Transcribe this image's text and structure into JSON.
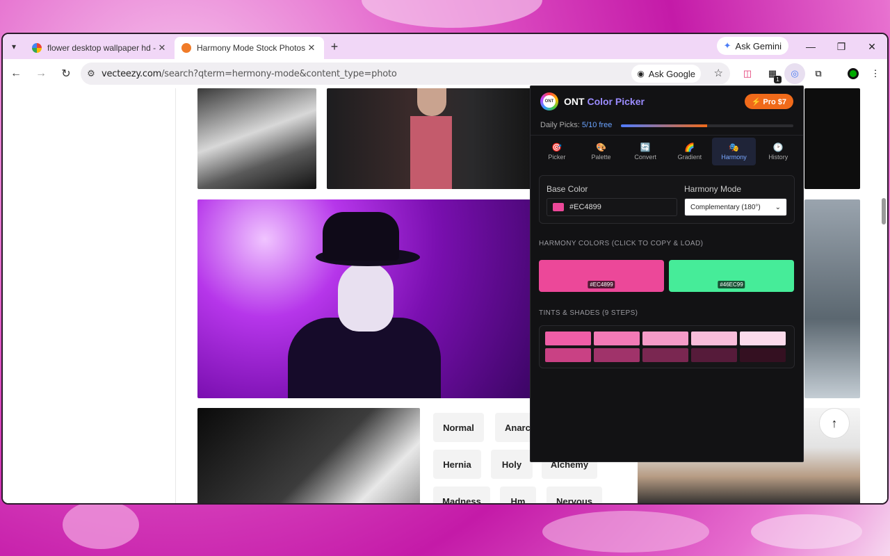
{
  "browser": {
    "tabs": [
      {
        "title": "flower desktop wallpaper hd - G",
        "favicon_color": "#4285f4"
      },
      {
        "title": "Harmony Mode Stock Photos, I",
        "favicon_color": "#f07b28"
      }
    ],
    "new_tab": "+",
    "gemini_label": "Ask Gemini",
    "url_host": "vecteezy.com",
    "url_rest": "/search?qterm=hermony-mode&content_type=photo",
    "ask_google_label": "Ask Google",
    "extension_badge": "1"
  },
  "page": {
    "chips": [
      {
        "label": "Normal"
      },
      {
        "label": "Anarch"
      },
      {
        "label": "Hernia"
      },
      {
        "label": "Holy"
      },
      {
        "label": "Alchemy"
      },
      {
        "label": "Madness"
      },
      {
        "label": "Hm"
      },
      {
        "label": "Nervous"
      }
    ]
  },
  "popup": {
    "logo_text": "ONT",
    "title_main": "ONT",
    "title_accent": "Color Picker",
    "pro_label": "⚡ Pro $7",
    "daily_label": "Daily Picks:",
    "daily_value": "5/10 free",
    "daily_progress": 0.5,
    "tabs": [
      {
        "label": "Picker",
        "icon": "🎯"
      },
      {
        "label": "Palette",
        "icon": "🎨"
      },
      {
        "label": "Convert",
        "icon": "🔄"
      },
      {
        "label": "Gradient",
        "icon": "🌈"
      },
      {
        "label": "Harmony",
        "icon": "🎭"
      },
      {
        "label": "History",
        "icon": "🕑"
      }
    ],
    "base_color_label": "Base Color",
    "base_color_value": "#EC4899",
    "harmony_mode_label": "Harmony Mode",
    "harmony_mode_value": "Complementary (180°)",
    "harmony_colors_label": "HARMONY COLORS (CLICK TO COPY & LOAD)",
    "harmony_colors": [
      "#EC4899",
      "#46EC99"
    ],
    "tints_label": "TINTS & SHADES (9 STEPS)",
    "tints": [
      "#ef5ea7",
      "#f27ab6",
      "#f59bc8",
      "#f8bdda",
      "#fbdbeb"
    ],
    "shades": [
      "#c94184",
      "#a0336a",
      "#7a2751",
      "#561b3a",
      "#341021"
    ]
  }
}
